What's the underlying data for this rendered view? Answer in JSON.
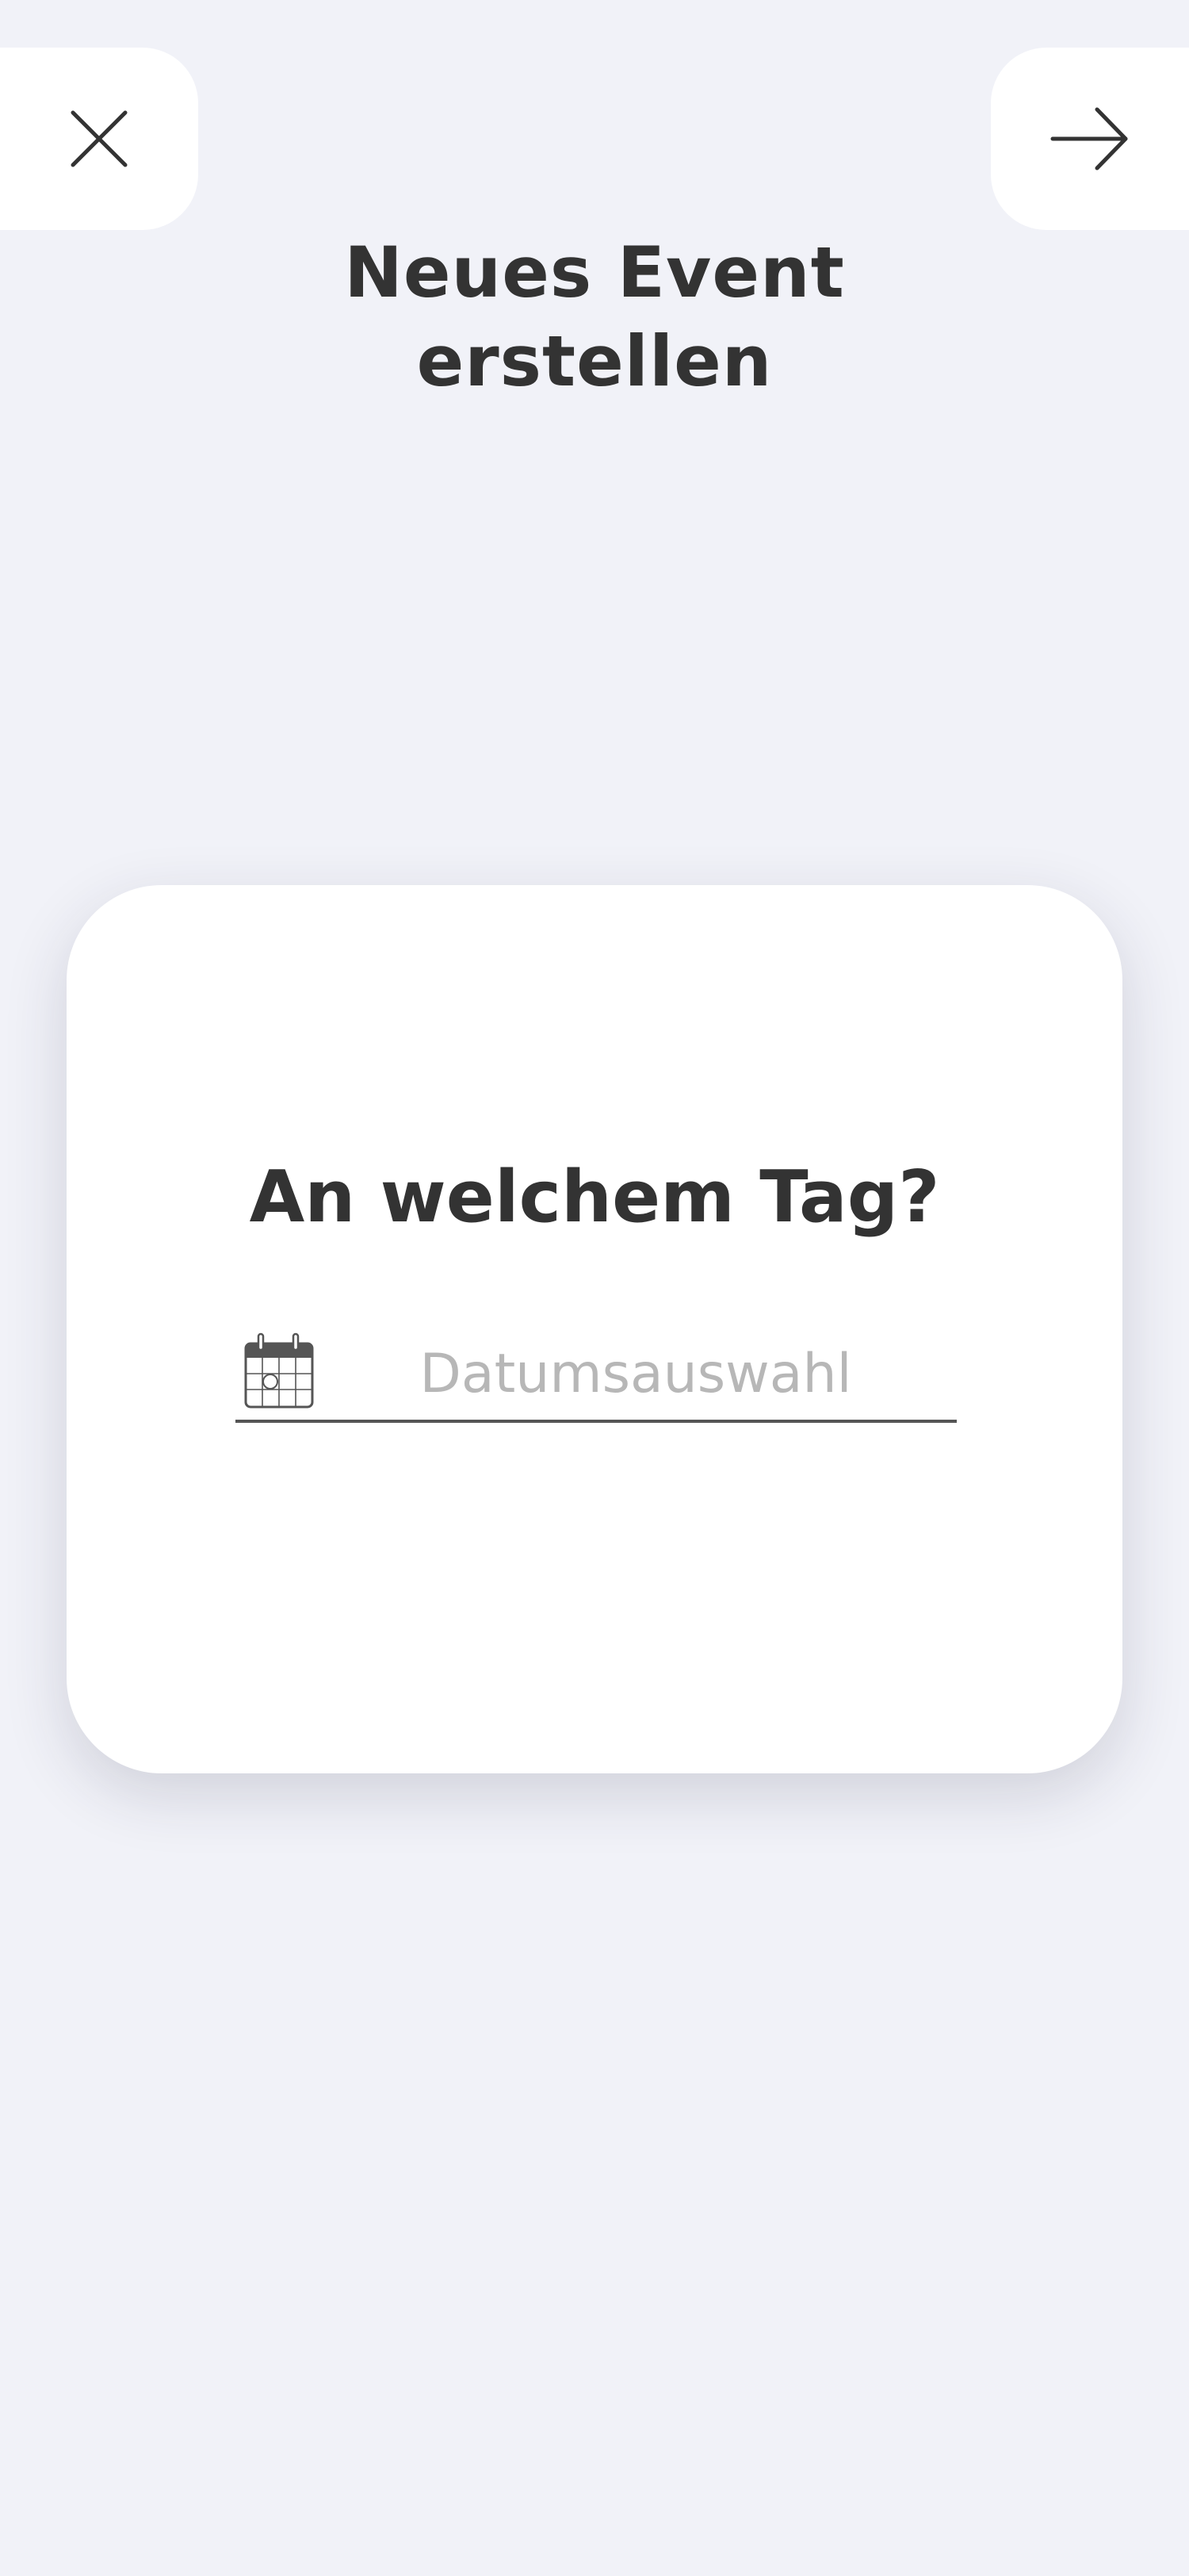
{
  "header": {
    "title": "Neues Event\nerstellen",
    "close_icon": "close-icon",
    "next_icon": "arrow-right-icon"
  },
  "card": {
    "question": "An welchem Tag?",
    "date_field": {
      "placeholder": "Datumsauswahl",
      "icon": "calendar-icon"
    }
  },
  "colors": {
    "background": "#f1f2f8",
    "card": "#ffffff",
    "text": "#333333",
    "placeholder": "#b7b7b7",
    "underline": "#555555"
  }
}
